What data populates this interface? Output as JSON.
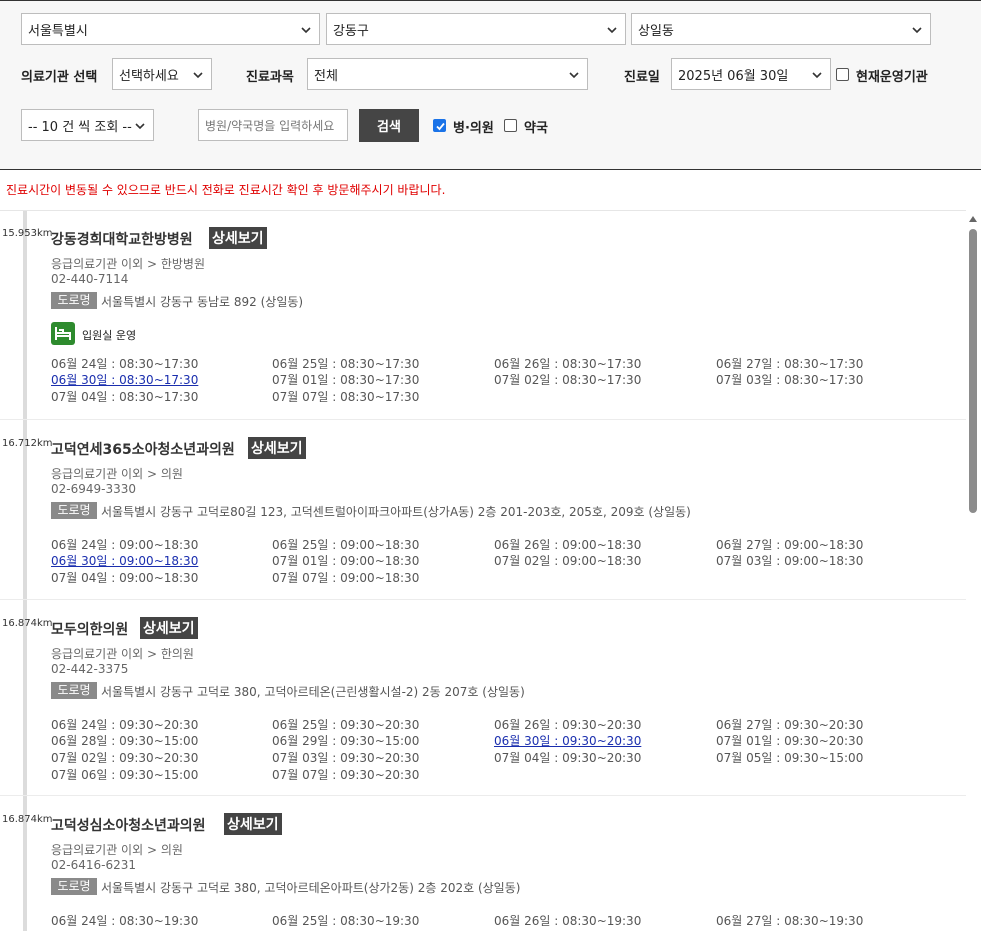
{
  "filters": {
    "sido": "서울특별시",
    "sigungu": "강동구",
    "dong": "상일동",
    "inst_label": "의료기관 선택",
    "inst_value": "선택하세요",
    "dept_label": "진료과목",
    "dept_value": "전체",
    "date_label": "진료일",
    "date_value": "2025년 06월 30일",
    "operating_label": "현재운영기관",
    "page_size": "-- 10 건 씩 조회 --",
    "search_placeholder": "병원/약국명을 입력하세요",
    "search_button": "검색",
    "clinic_label": "병·의원",
    "pharmacy_label": "약국"
  },
  "notice": "진료시간이 변동될 수 있으므로 반드시 전화로 진료시간 확인 후 방문해주시기 바랍니다.",
  "detail_label": "상세보기",
  "road_label": "도로명",
  "facilities": [
    {
      "distance": "15.953km",
      "name": "강동경희대학교한방병원",
      "category": "응급의료기관 이외 > 한방병원",
      "phone": "02-440-7114",
      "address": "서울특별시 강동구 동남로 892 (상일동)",
      "badge": "입원실 운영",
      "hours": [
        [
          "06월 24일 : 08:30~17:30",
          "06월 25일 : 08:30~17:30",
          "06월 26일 : 08:30~17:30",
          "06월 27일 : 08:30~17:30"
        ],
        [
          "06월 30일 : 08:30~17:30",
          "07월 01일 : 08:30~17:30",
          "07월 02일 : 08:30~17:30",
          "07월 03일 : 08:30~17:30"
        ],
        [
          "07월 04일 : 08:30~17:30",
          "07월 07일 : 08:30~17:30",
          "",
          ""
        ]
      ]
    },
    {
      "distance": "16.712km",
      "name": "고덕연세365소아청소년과의원",
      "category": "응급의료기관 이외 > 의원",
      "phone": "02-6949-3330",
      "address": "서울특별시 강동구 고덕로80길 123, 고덕센트럴아이파크아파트(상가A동) 2층 201-203호, 205호, 209호 (상일동)",
      "hours": [
        [
          "06월 24일 : 09:00~18:30",
          "06월 25일 : 09:00~18:30",
          "06월 26일 : 09:00~18:30",
          "06월 27일 : 09:00~18:30"
        ],
        [
          "06월 30일 : 09:00~18:30",
          "07월 01일 : 09:00~18:30",
          "07월 02일 : 09:00~18:30",
          "07월 03일 : 09:00~18:30"
        ],
        [
          "07월 04일 : 09:00~18:30",
          "07월 07일 : 09:00~18:30",
          "",
          ""
        ]
      ]
    },
    {
      "distance": "16.874km",
      "name": "모두의한의원",
      "category": "응급의료기관 이외 > 한의원",
      "phone": "02-442-3375",
      "address": "서울특별시 강동구 고덕로 380, 고덕아르테온(근린생활시설-2) 2동 207호 (상일동)",
      "hours": [
        [
          "06월 24일 : 09:30~20:30",
          "06월 25일 : 09:30~20:30",
          "06월 26일 : 09:30~20:30",
          "06월 27일 : 09:30~20:30"
        ],
        [
          "06월 28일 : 09:30~15:00",
          "06월 29일 : 09:30~15:00",
          "06월 30일 : 09:30~20:30",
          "07월 01일 : 09:30~20:30"
        ],
        [
          "07월 02일 : 09:30~20:30",
          "07월 03일 : 09:30~20:30",
          "07월 04일 : 09:30~20:30",
          "07월 05일 : 09:30~15:00"
        ],
        [
          "07월 06일 : 09:30~15:00",
          "07월 07일 : 09:30~20:30",
          "",
          ""
        ]
      ]
    },
    {
      "distance": "16.874km",
      "name": "고덕성심소아청소년과의원",
      "category": "응급의료기관 이외 > 의원",
      "phone": "02-6416-6231",
      "address": "서울특별시 강동구 고덕로 380, 고덕아르테온아파트(상가2동) 2층 202호 (상일동)",
      "hours": [
        [
          "06월 24일 : 08:30~19:30",
          "06월 25일 : 08:30~19:30",
          "06월 26일 : 08:30~19:30",
          "06월 27일 : 08:30~19:30"
        ]
      ]
    }
  ]
}
